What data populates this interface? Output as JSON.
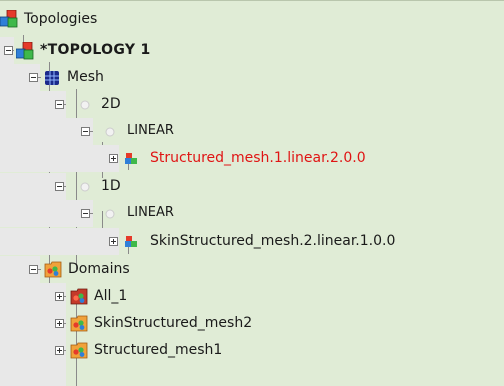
{
  "tree": {
    "root_label": "Topologies",
    "topology_label": "*TOPOLOGY 1",
    "mesh_label": "Mesh",
    "dim2_label": "2D",
    "linear2_label": "LINEAR",
    "structured_mesh_label": "Structured_mesh.1.linear.2.0.0",
    "dim1_label": "1D",
    "linear1_label": "LINEAR",
    "skin_mesh_label": "SkinStructured_mesh.2.linear.1.0.0",
    "domains_label": "Domains",
    "domain_all_label": "All_1",
    "domain_skin_label": "SkinStructured_mesh2",
    "domain_structured_label": "Structured_mesh1"
  },
  "colors": {
    "panel_background": "#e0ecd6",
    "selected_text": "#e01414",
    "tree_line": "#8a8a8a"
  }
}
